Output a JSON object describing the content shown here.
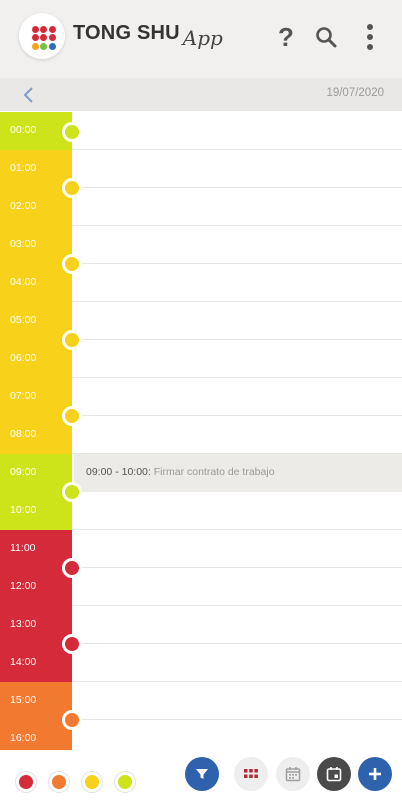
{
  "header": {
    "title": "TONG SHU",
    "title_suffix": "App",
    "icons": [
      "logo-icon",
      "help-icon",
      "search-icon",
      "more-vertical-icon"
    ],
    "help_glyph": "?",
    "logo_colors": [
      "#d42a3a",
      "#d42a3a",
      "#d42a3a",
      "#d42a3a",
      "#d42a3a",
      "#d42a3a",
      "#f6a31a",
      "#6cc24a",
      "#2f6fb7"
    ]
  },
  "datebar": {
    "date": "19/07/2020"
  },
  "colors": {
    "lime": "#cde41a",
    "yellow": "#f8d21a",
    "red": "#d42a3a",
    "orange": "#f27a30",
    "blue_button": "#2f62ad",
    "dark_button": "#4a4a4a",
    "grey_button": "#eeeeee"
  },
  "hours": [
    {
      "label": "00:00",
      "color": "lime"
    },
    {
      "label": "01:00",
      "color": "yellow"
    },
    {
      "label": "02:00",
      "color": "yellow"
    },
    {
      "label": "03:00",
      "color": "yellow"
    },
    {
      "label": "04:00",
      "color": "yellow"
    },
    {
      "label": "05:00",
      "color": "yellow"
    },
    {
      "label": "06:00",
      "color": "yellow"
    },
    {
      "label": "07:00",
      "color": "yellow"
    },
    {
      "label": "08:00",
      "color": "yellow"
    },
    {
      "label": "09:00",
      "color": "lime"
    },
    {
      "label": "10:00",
      "color": "lime"
    },
    {
      "label": "11:00",
      "color": "red"
    },
    {
      "label": "12:00",
      "color": "red"
    },
    {
      "label": "13:00",
      "color": "red"
    },
    {
      "label": "14:00",
      "color": "red"
    },
    {
      "label": "15:00",
      "color": "orange"
    },
    {
      "label": "16:00",
      "color": "orange"
    }
  ],
  "nodes": [
    {
      "color": "lime"
    },
    {
      "color": "yellow"
    },
    {
      "color": "yellow"
    },
    {
      "color": "yellow"
    },
    {
      "color": "yellow"
    },
    {
      "color": "lime"
    },
    {
      "color": "red"
    },
    {
      "color": "red"
    },
    {
      "color": "orange"
    }
  ],
  "event": {
    "time": "09:00 - 10:00:",
    "title": "Firmar contrato de trabajo"
  },
  "legend": [
    {
      "name": "red",
      "color": "#d42a3a"
    },
    {
      "name": "orange",
      "color": "#f27a30"
    },
    {
      "name": "yellow",
      "color": "#f8d21a"
    },
    {
      "name": "lime",
      "color": "#cde41a"
    }
  ],
  "bottom_buttons": [
    "filter-icon",
    "grid-view-icon",
    "calendar-icon",
    "calendar-today-icon",
    "add-icon"
  ]
}
